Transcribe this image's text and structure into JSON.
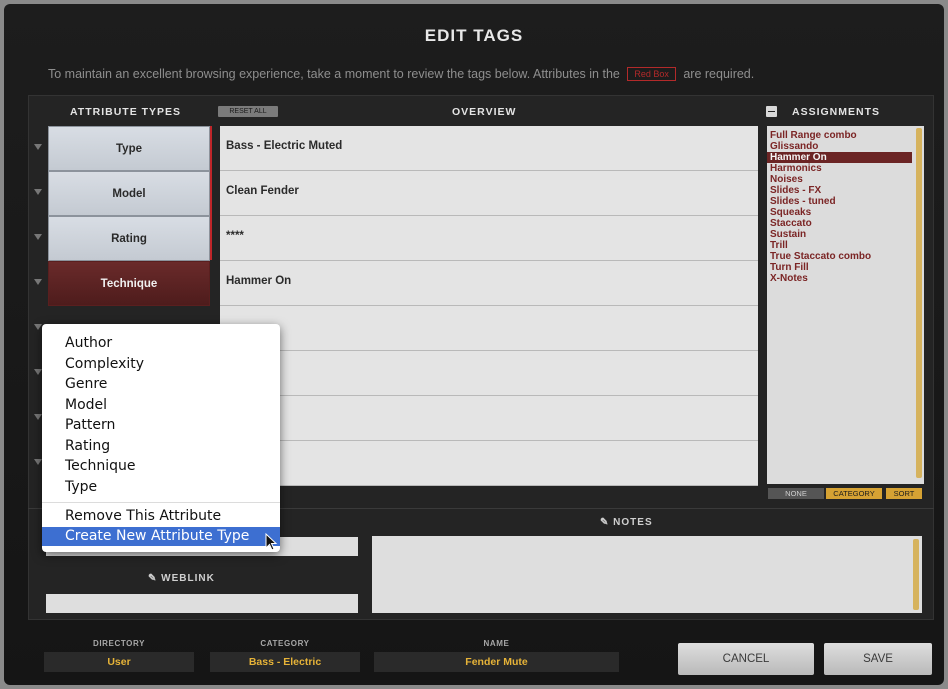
{
  "dialog": {
    "title": "EDIT TAGS",
    "subtitle_before": "To maintain an excellent browsing experience, take a moment to review the tags below.  Attributes in the",
    "subtitle_box": "Red Box",
    "subtitle_after": "are required."
  },
  "headers": {
    "attribute_types": "ATTRIBUTE TYPES",
    "reset_all": "RESET ALL",
    "overview": "OVERVIEW",
    "assignments": "ASSIGNMENTS",
    "notes": "NOTES",
    "weblink": "WEBLINK"
  },
  "rows": [
    {
      "attribute": "Type",
      "value": "Bass - Electric Muted",
      "active": false
    },
    {
      "attribute": "Model",
      "value": "Clean Fender",
      "active": false
    },
    {
      "attribute": "Rating",
      "value": "****",
      "active": false
    },
    {
      "attribute": "Technique",
      "value": "Hammer On",
      "active": true
    },
    {
      "attribute": "",
      "value": "",
      "active": false
    },
    {
      "attribute": "",
      "value": "",
      "active": false
    },
    {
      "attribute": "",
      "value": "",
      "active": false
    },
    {
      "attribute": "",
      "value": "",
      "active": false
    }
  ],
  "assignments": {
    "items": [
      "Full Range combo",
      "Glissando",
      "Hammer On",
      "Harmonics",
      "Noises",
      "Slides - FX",
      "Slides - tuned",
      "Squeaks",
      "Staccato",
      "Sustain",
      "Trill",
      "True Staccato combo",
      "Turn Fill",
      "X-Notes"
    ],
    "selected": "Hammer On",
    "footer": {
      "none": "NONE",
      "category": "CATEGORY",
      "sort": "SORT"
    }
  },
  "context_menu": {
    "items": [
      "Author",
      "Complexity",
      "Genre",
      "Model",
      "Pattern",
      "Rating",
      "Technique",
      "Type"
    ],
    "remove": "Remove This Attribute",
    "create": "Create New Attribute Type",
    "highlighted": "Create New Attribute Type"
  },
  "bottom": {
    "directory_label": "DIRECTORY",
    "directory_value": "User",
    "category_label": "CATEGORY",
    "category_value": "Bass - Electric",
    "name_label": "NAME",
    "name_value": "Fender Mute",
    "cancel": "CANCEL",
    "save": "SAVE"
  },
  "colors": {
    "accent_gold": "#e6b338",
    "required_red": "#c0262a",
    "selection_blue": "#3d6fd1",
    "active_row": "#6a2a2a"
  }
}
